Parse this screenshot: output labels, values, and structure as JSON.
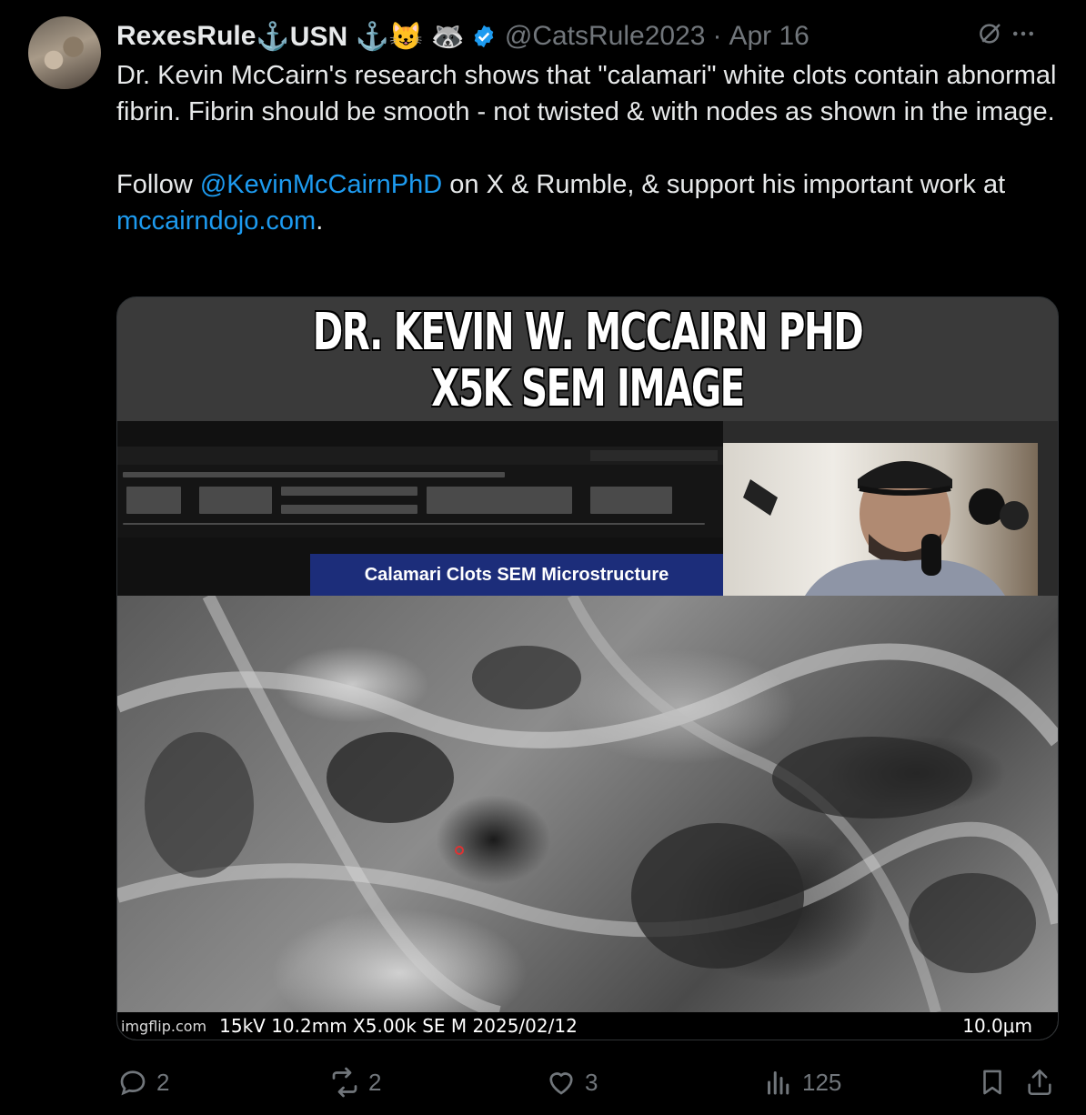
{
  "tweet": {
    "display_name": "RexesRule",
    "name_suffix": " ⚓USN ⚓😺 🦝",
    "handle": "@CatsRule2023",
    "separator": "·",
    "date": "Apr 16",
    "text_line1": "Dr. Kevin McCairn's research shows that \"calamari\" white clots contain abnormal fibrin.  Fibrin should be smooth - not twisted & with nodes as shown in the image.",
    "text_follow_prefix": "Follow ",
    "mention": "@KevinMcCairnPhD",
    "text_follow_mid": " on X & Rumble, & support his important work at ",
    "url": "mccairndojo.com",
    "text_follow_suffix": "."
  },
  "media": {
    "meme_title_line1": "DR. KEVIN W. MCCAIRN PHD",
    "meme_title_line2": "X5K SEM IMAGE",
    "slide_title": "Calamari Clots SEM Microstructure",
    "sem_info": "15kV 10.2mm X5.00k SE M 2025/02/12",
    "sem_watermark": "imgflip.com",
    "sem_scale": "10.0μm"
  },
  "actions": {
    "replies": "2",
    "reposts": "2",
    "likes": "3",
    "views": "125"
  },
  "colors": {
    "background": "#000000",
    "text": "#e7e9ea",
    "secondary": "#71767b",
    "link": "#1d9bf0",
    "verified": "#1d9bf0"
  }
}
